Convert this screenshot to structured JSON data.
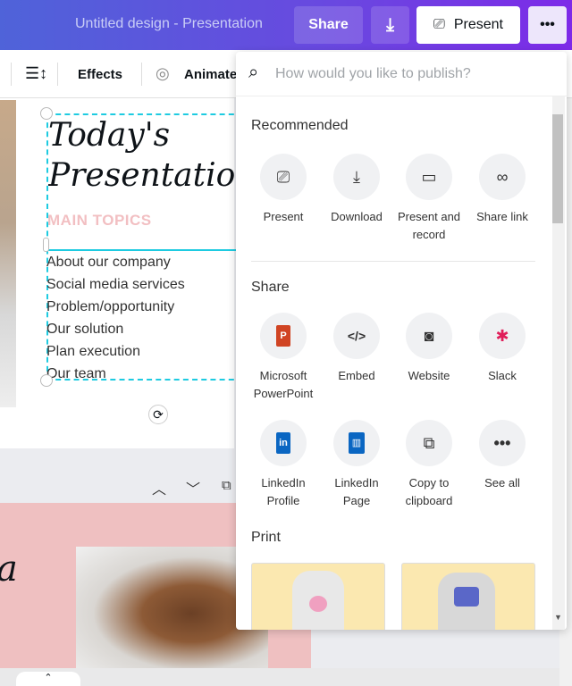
{
  "header": {
    "title": "Untitled design - Presentation",
    "share": "Share",
    "present": "Present",
    "more": "•••"
  },
  "toolbar": {
    "effects": "Effects",
    "animate": "Animate"
  },
  "slide1": {
    "title_line1": "Today's",
    "title_line2": "Presentation",
    "subtitle": "MAIN TOPICS",
    "topics": [
      "About our company",
      "Social media services",
      "Problem/opportunity",
      "Our solution",
      "Plan execution",
      "Our team"
    ]
  },
  "slide2": {
    "partial_text": "a"
  },
  "publish": {
    "search_placeholder": "How would you like to publish?",
    "recommended_title": "Recommended",
    "recommended": [
      {
        "label": "Present",
        "icon": "present-icon"
      },
      {
        "label": "Download",
        "icon": "download-icon"
      },
      {
        "label": "Present and record",
        "icon": "video-camera-icon"
      },
      {
        "label": "Share link",
        "icon": "link-icon"
      }
    ],
    "share_title": "Share",
    "share": [
      {
        "label": "Microsoft PowerPoint",
        "icon": "powerpoint-icon"
      },
      {
        "label": "Embed",
        "icon": "code-icon"
      },
      {
        "label": "Website",
        "icon": "website-icon"
      },
      {
        "label": "Slack",
        "icon": "slack-icon"
      },
      {
        "label": "LinkedIn Profile",
        "icon": "linkedin-icon"
      },
      {
        "label": "LinkedIn Page",
        "icon": "linkedin-page-icon"
      },
      {
        "label": "Copy to clipboard",
        "icon": "copy-icon"
      },
      {
        "label": "See all",
        "icon": "more-icon"
      }
    ],
    "print_title": "Print"
  },
  "colors": {
    "accent": "#7d2ae8",
    "selection": "#1ecbe1",
    "pink": "#efc0c1",
    "topic_pink": "#f2bfc2"
  }
}
